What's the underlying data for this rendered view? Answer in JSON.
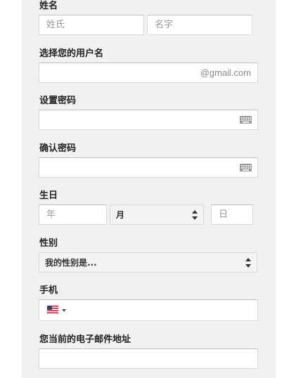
{
  "name": {
    "label": "姓名",
    "last_placeholder": "姓氏",
    "first_placeholder": "名字"
  },
  "username": {
    "label": "选择您的用户名",
    "suffix": "@gmail.com"
  },
  "password": {
    "label": "设置密码",
    "icon": "keyboard-icon"
  },
  "confirm_password": {
    "label": "确认密码",
    "icon": "keyboard-icon"
  },
  "birthday": {
    "label": "生日",
    "year_placeholder": "年",
    "month_value": "月",
    "day_placeholder": "日"
  },
  "gender": {
    "label": "性别",
    "value": "我的性别是..."
  },
  "phone": {
    "label": "手机",
    "country_icon": "us-flag-icon"
  },
  "email": {
    "label": "您当前的电子邮件地址"
  }
}
